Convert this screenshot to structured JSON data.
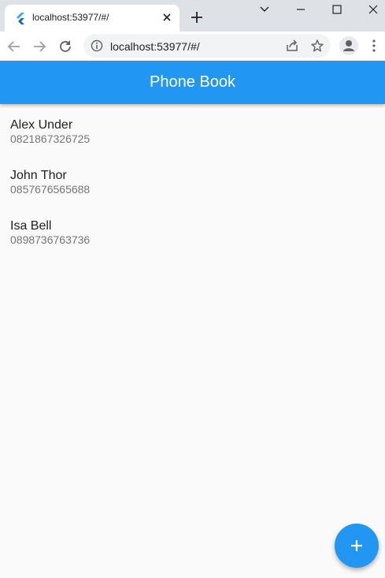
{
  "browser": {
    "tab": {
      "title": "localhost:53977/#/",
      "favicon": "flutter-icon"
    },
    "address_bar": {
      "url": "localhost:53977/#/"
    }
  },
  "app": {
    "title": "Phone Book",
    "accent_color": "#2196f3",
    "contacts": [
      {
        "name": "Alex Under",
        "phone": "0821867326725"
      },
      {
        "name": "John Thor",
        "phone": "0857676565688"
      },
      {
        "name": "Isa Bell",
        "phone": "0898736763736"
      }
    ],
    "fab": {
      "icon": "plus-icon"
    }
  }
}
